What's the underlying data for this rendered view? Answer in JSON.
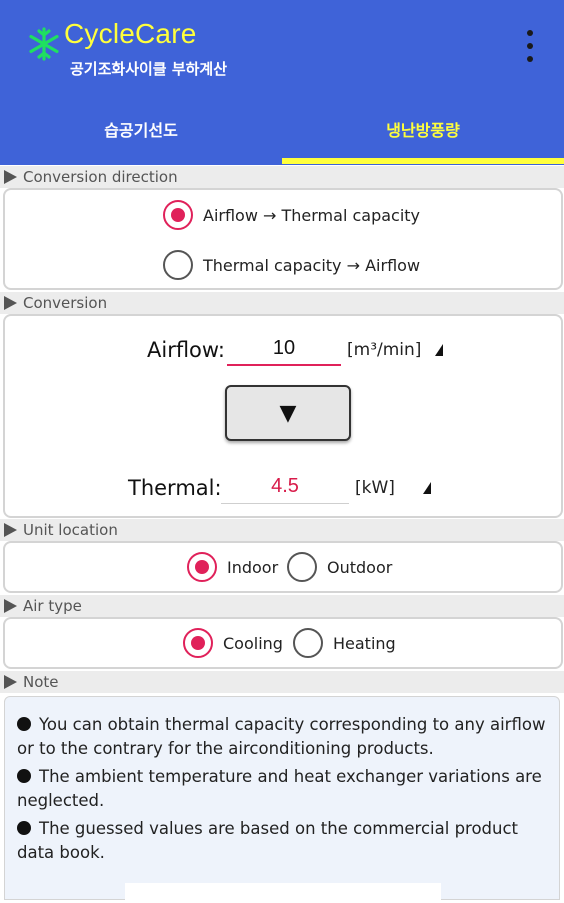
{
  "app": {
    "title": "CycleCare",
    "subtitle": "공기조화사이클 부하계산",
    "accent_color": "#3f63d8",
    "highlight_color": "#ffff3c",
    "menu_icon": "more-vert-icon",
    "logo_icon": "snowflake-icon"
  },
  "tabs": [
    {
      "label": "습공기선도",
      "active": false
    },
    {
      "label": "냉난방풍량",
      "active": true
    }
  ],
  "sections": {
    "conversion_direction": "Conversion direction",
    "conversion": "Conversion",
    "unit_location": "Unit location",
    "air_type": "Air type",
    "note": "Note"
  },
  "direction_options": [
    {
      "label": "Airflow → Thermal capacity",
      "checked": true
    },
    {
      "label": "Thermal capacity → Airflow",
      "checked": false
    }
  ],
  "conversion": {
    "airflow_label": "Airflow:",
    "airflow_value": "10",
    "airflow_unit": "[m³/min]",
    "convert_button_glyph": "▼",
    "thermal_label": "Thermal:",
    "thermal_value": "4.5",
    "thermal_unit": "[kW]"
  },
  "unit_location_options": [
    {
      "label": "Indoor",
      "checked": true
    },
    {
      "label": "Outdoor",
      "checked": false
    }
  ],
  "air_type_options": [
    {
      "label": "Cooling",
      "checked": true
    },
    {
      "label": "Heating",
      "checked": false
    }
  ],
  "notes": [
    "You can obtain thermal capacity corresponding to any airflow or to the contrary for the airconditioning products.",
    "The ambient temperature and heat exchanger variations are neglected.",
    "The guessed values are based on the commercial product data book."
  ],
  "colors": {
    "radio_checked": "#e0215a",
    "thermal_value": "#d81b4a"
  }
}
